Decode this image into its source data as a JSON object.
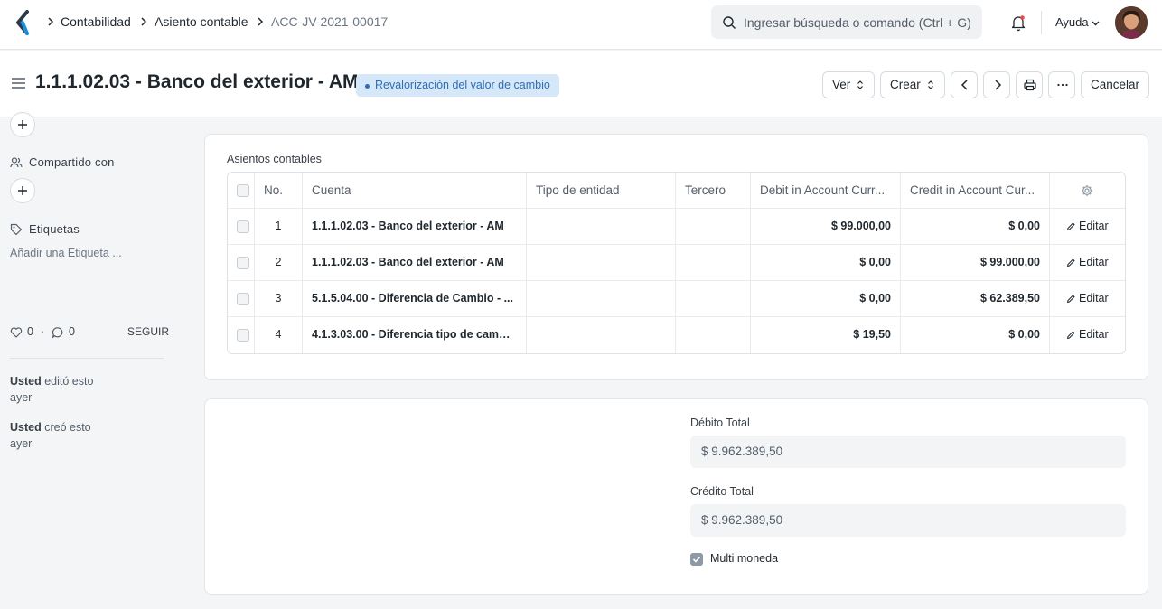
{
  "navbar": {
    "breadcrumbs": [
      "Contabilidad",
      "Asiento contable",
      "ACC-JV-2021-00017"
    ],
    "search_placeholder": "Ingresar búsqueda o comando (Ctrl + G)",
    "help_label": "Ayuda"
  },
  "header": {
    "title": "1.1.1.02.03 - Banco del exterior - AM",
    "status": "Revalorización del valor de cambio",
    "buttons": {
      "view": "Ver",
      "create": "Crear",
      "cancel": "Cancelar",
      "more": "..."
    }
  },
  "sidebar": {
    "shared_with": "Compartido con",
    "tags": "Etiquetas",
    "add_tag": "Añadir una Etiqueta ...",
    "likes": "0",
    "comments": "0",
    "follow": "SEGUIR",
    "activity": [
      {
        "user": "Usted",
        "action": "editó esto",
        "when": "ayer"
      },
      {
        "user": "Usted",
        "action": "creó esto",
        "when": "ayer"
      }
    ]
  },
  "entries": {
    "section_label": "Asientos contables",
    "columns": [
      "No.",
      "Cuenta",
      "Tipo de entidad",
      "Tercero",
      "Debit in Account Curr...",
      "Credit in Account Cur..."
    ],
    "edit_label": "Editar",
    "rows": [
      {
        "no": "1",
        "account": "1.1.1.02.03 - Banco del exterior - AM",
        "party_type": "",
        "party": "",
        "debit": "$ 99.000,00",
        "credit": "$ 0,00"
      },
      {
        "no": "2",
        "account": "1.1.1.02.03 - Banco del exterior - AM",
        "party_type": "",
        "party": "",
        "debit": "$ 0,00",
        "credit": "$ 99.000,00"
      },
      {
        "no": "3",
        "account": "5.1.5.04.00 - Diferencia de Cambio - ...",
        "party_type": "",
        "party": "",
        "debit": "$ 0,00",
        "credit": "$ 62.389,50"
      },
      {
        "no": "4",
        "account": "4.1.3.03.00 - Diferencia tipo de cambi...",
        "party_type": "",
        "party": "",
        "debit": "$ 19,50",
        "credit": "$ 0,00"
      }
    ]
  },
  "totals": {
    "debit_label": "Débito Total",
    "debit_value": "$ 9.962.389,50",
    "credit_label": "Crédito Total",
    "credit_value": "$ 9.962.389,50",
    "multi_currency_label": "Multi moneda",
    "multi_currency_checked": true
  },
  "colors": {
    "status_bg": "#d5e8fa",
    "status_text": "#2f6db5",
    "page_bg": "#f4f5f6"
  }
}
